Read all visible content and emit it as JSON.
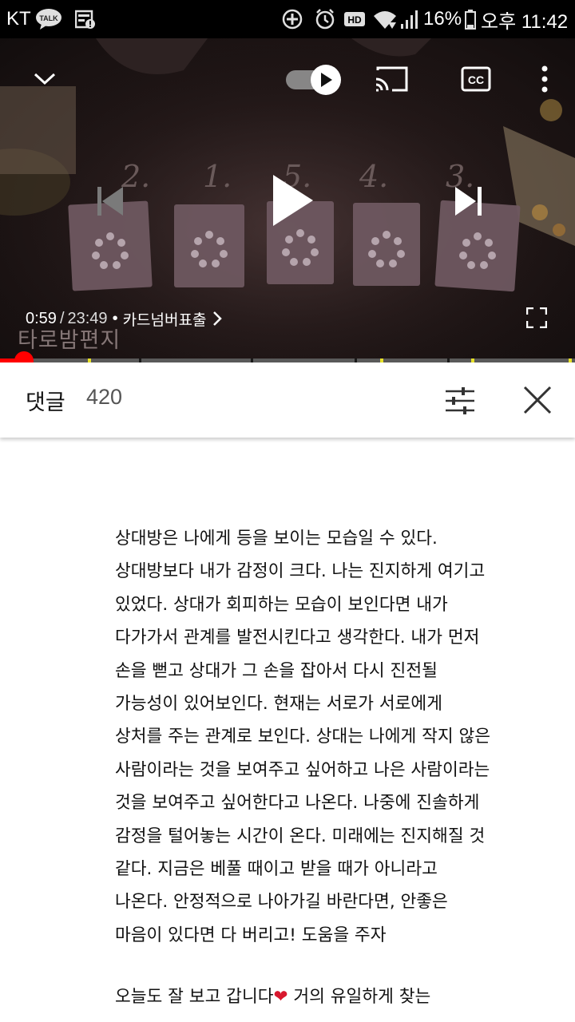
{
  "status_bar": {
    "carrier": "KT",
    "battery_percent": "16%",
    "clock": "오후 11:42",
    "icons": [
      "kakaotalk-icon",
      "news-icon",
      "sync-icon",
      "alarm-icon",
      "hd-icon",
      "wifi-icon",
      "signal-icon",
      "battery-icon"
    ]
  },
  "player": {
    "current_time": "0:59",
    "separator": "/",
    "duration": "23:49",
    "dot": "•",
    "chapter_title": "카드넘버표출",
    "watermark": "타로밤편지",
    "progress_fraction": 0.041,
    "card_labels": [
      "2.",
      "1.",
      "5.",
      "4.",
      "3."
    ],
    "icons": [
      "chevron-down-icon",
      "autoplay-toggle-icon",
      "cast-icon",
      "cc-icon",
      "more-vert-icon",
      "skip-previous-icon",
      "play-icon",
      "skip-next-icon",
      "fullscreen-icon"
    ]
  },
  "comments": {
    "title": "댓글",
    "count": "420",
    "icons": [
      "filter-sort-icon",
      "close-icon"
    ],
    "body_lines": [
      "상대방은 나에게 등을 보이는 모습일 수 있다.",
      "상대방보다 내가 감정이 크다. 나는 진지하게 여기고",
      "있었다. 상대가 회피하는 모습이 보인다면 내가",
      "다가가서 관계를 발전시킨다고 생각한다. 내가 먼저",
      "손을 뻗고 상대가 그 손을 잡아서 다시 진전될",
      "가능성이 있어보인다. 현재는 서로가 서로에게",
      "상처를 주는 관계로 보인다. 상대는 나에게 작지 않은",
      "사람이라는 것을 보여주고 싶어하고 나은 사람이라는",
      "것을 보여주고 싶어한다고 나온다. 나중에 진솔하게",
      "감정을 털어놓는 시간이 온다. 미래에는 진지해질 것",
      "같다. 지금은 베풀 때이고 받을 때가 아니라고",
      "나온다. 안정적으로 나아가길 바란다면, 안좋은",
      "마음이 있다면 다 버리고! 도움을 주자"
    ],
    "second_line_before": "오늘도 잘 보고 갑니다",
    "second_line_heart": "❤",
    "second_line_after": " 거의 유일하게 찾는"
  }
}
